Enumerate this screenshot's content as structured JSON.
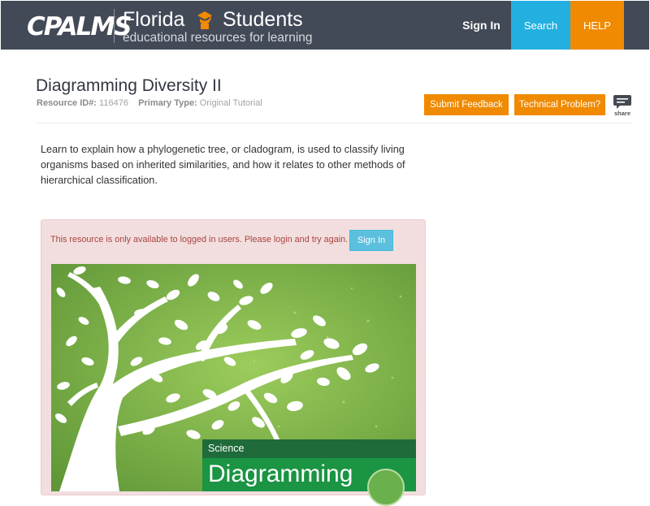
{
  "header": {
    "logo_text": "CPALMS",
    "brand_title_1": "Florida",
    "brand_title_2": "Students",
    "brand_subtitle": "educational resources for learning",
    "nav": {
      "sign_in": "Sign In",
      "search": "Search",
      "help": "HELP"
    },
    "colors": {
      "bar": "#424957",
      "search": "#23b0e1",
      "help": "#f08a00"
    }
  },
  "resource": {
    "title": "Diagramming Diversity II",
    "id_label": "Resource ID#:",
    "id_value": "116476",
    "type_label": "Primary Type:",
    "type_value": "Original Tutorial",
    "submit_feedback": "Submit Feedback",
    "technical_problem": "Technical Problem?",
    "share_label": "share",
    "description": "Learn to explain how a phylogenetic tree, or cladogram, is used to classify living organisms based on inherited similarities, and how it relates to other methods of hierarchical classification."
  },
  "alert": {
    "message": "This resource is only available to logged in users. Please login and try again.",
    "sign_in": "Sign In"
  },
  "cover": {
    "subject": "Science",
    "title": "Diagramming"
  }
}
